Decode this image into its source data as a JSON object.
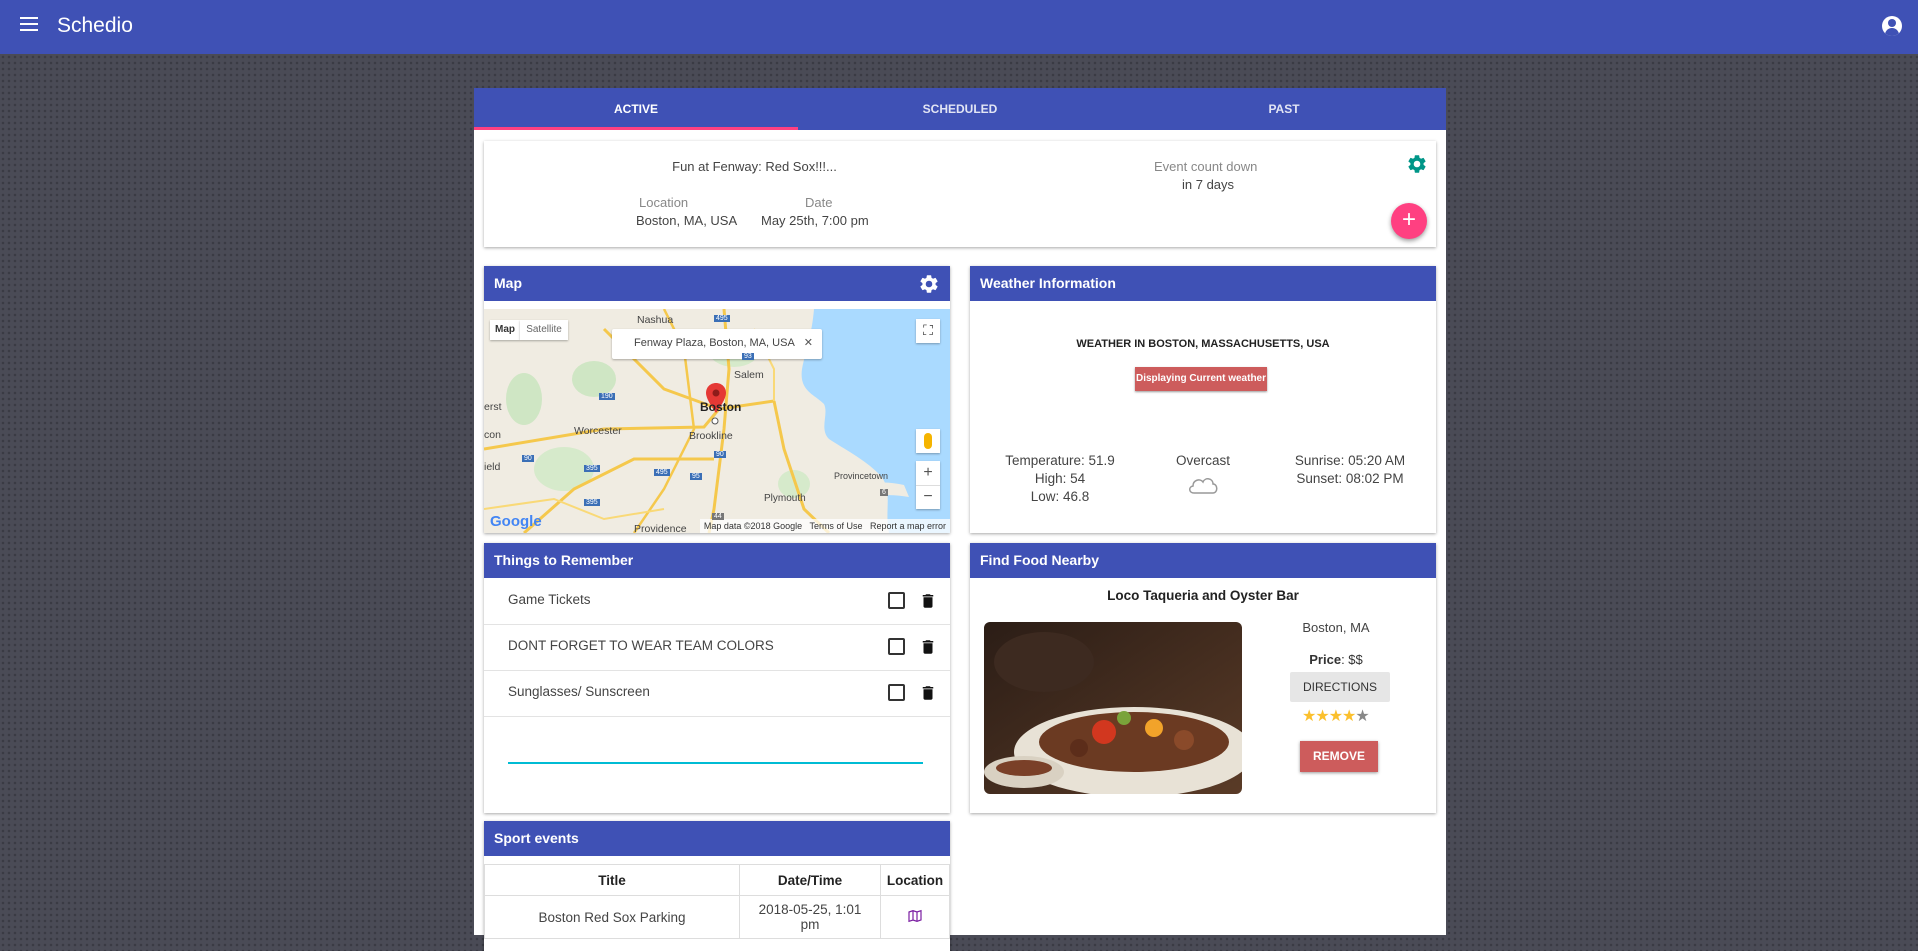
{
  "app": {
    "title": "Schedio",
    "menu_icon": "menu-icon",
    "account_icon": "account-circle-icon"
  },
  "tabs": [
    {
      "label": "ACTIVE",
      "active": true
    },
    {
      "label": "SCHEDULED",
      "active": false
    },
    {
      "label": "PAST",
      "active": false
    }
  ],
  "event": {
    "title": "Fun at Fenway: Red Sox!!!...",
    "location_label": "Location",
    "location": "Boston, MA, USA",
    "date_label": "Date",
    "date": "May 25th, 7:00 pm",
    "countdown_label": "Event count down",
    "countdown": "in 7 days",
    "add_label": "+"
  },
  "map": {
    "title": "Map",
    "type_map": "Map",
    "type_satellite": "Satellite",
    "info_window": "Fenway Plaza, Boston, MA, USA",
    "info_close": "✕",
    "zoom_in": "+",
    "zoom_out": "−",
    "logo": "Google",
    "footer": [
      "Map data ©2018 Google",
      "Terms of Use",
      "Report a map error"
    ],
    "places": [
      "Nashua",
      "Salem",
      "Boston",
      "Brookline",
      "Worcester",
      "Plymouth",
      "Provincetown",
      "Providence",
      "erst",
      "con",
      "ield"
    ],
    "shields": [
      "495",
      "93",
      "190",
      "90",
      "90",
      "395",
      "495",
      "95",
      "395",
      "44",
      "6"
    ]
  },
  "weather": {
    "header": "Weather Information",
    "title": "WEATHER IN BOSTON, MASSACHUSETTS, USA",
    "badge": "Displaying Current weather",
    "temperature": "Temperature: 51.9",
    "high": "High: 54",
    "low": "Low: 46.8",
    "condition": "Overcast",
    "sunrise": "Sunrise: 05:20 AM",
    "sunset": "Sunset: 08:02 PM"
  },
  "things": {
    "header": "Things to Remember",
    "items": [
      "Game Tickets",
      "DONT FORGET TO WEAR TEAM COLORS",
      "Sunglasses/ Sunscreen"
    ],
    "input_value": ""
  },
  "food": {
    "header": "Find Food Nearby",
    "name": "Loco Taqueria and Oyster Bar",
    "city": "Boston, MA",
    "price_label": "Price",
    "price": ": $$",
    "directions": "DIRECTIONS",
    "rating": 4,
    "rating_max": 5,
    "remove": "REMOVE"
  },
  "sports": {
    "header": "Sport events",
    "columns": [
      "Title",
      "Date/Time",
      "Location"
    ],
    "rows": [
      {
        "title": "Boston Red Sox Parking",
        "datetime": "2018-05-25, 1:01 pm",
        "location_icon": "map-icon"
      }
    ]
  },
  "colors": {
    "primary": "#3f51b5",
    "accent": "#ff4081",
    "teal": "#009688",
    "danger": "#cd5c5c",
    "star": "#fbc02d"
  }
}
